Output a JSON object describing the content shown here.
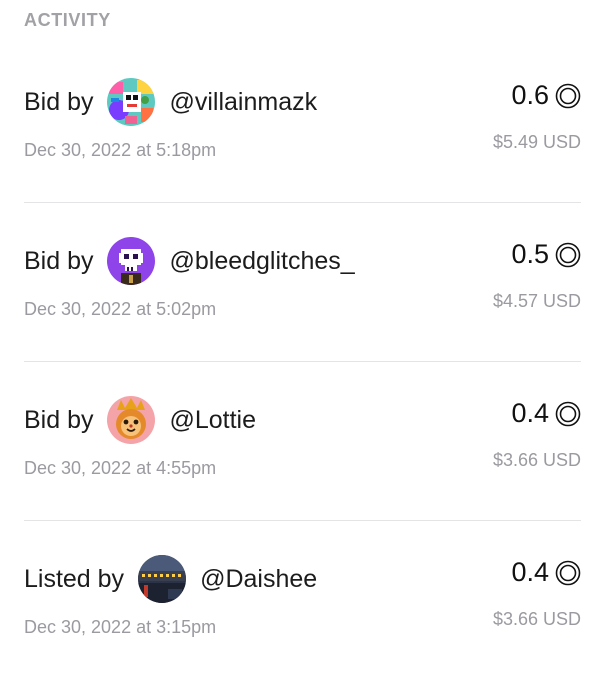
{
  "section_title": "ACTIVITY",
  "currency_icon": "circle-coin-icon",
  "colors": {
    "muted": "#9a9aa0",
    "divider": "#e4e4e7",
    "text": "#1c1c1c"
  },
  "activities": [
    {
      "action": "Bid by",
      "username": "@villainmazk",
      "date": "Dec 30, 2022 at 5:18pm",
      "price": "0.6",
      "usd": "$5.49 USD",
      "avatar": "colorful-collage-avatar"
    },
    {
      "action": "Bid by",
      "username": "@bleedglitches_",
      "date": "Dec 30, 2022 at 5:02pm",
      "price": "0.5",
      "usd": "$4.57 USD",
      "avatar": "purple-pixel-skull-avatar"
    },
    {
      "action": "Bid by",
      "username": "@Lottie",
      "date": "Dec 30, 2022 at 4:55pm",
      "price": "0.4",
      "usd": "$3.66 USD",
      "avatar": "orange-cat-crown-avatar"
    },
    {
      "action": "Listed by",
      "username": "@Daishee",
      "date": "Dec 30, 2022 at 3:15pm",
      "price": "0.4",
      "usd": "$3.66 USD",
      "avatar": "night-city-avatar"
    }
  ]
}
